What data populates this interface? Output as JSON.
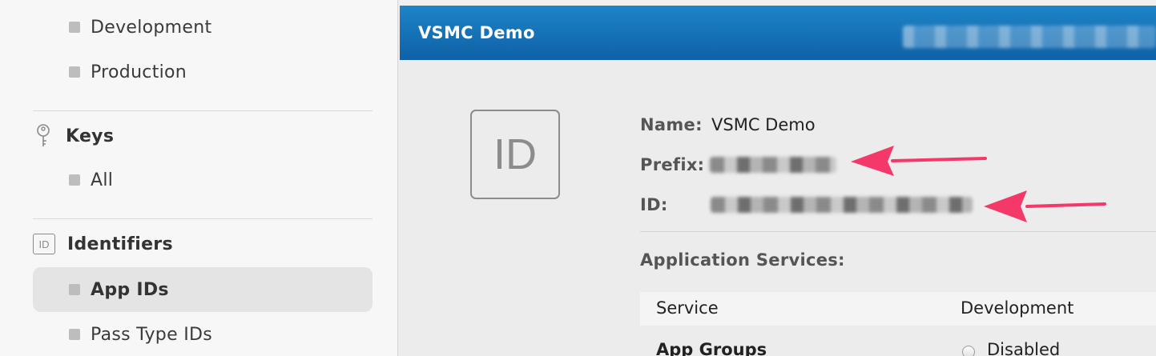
{
  "sidebar": {
    "certificates_items": [
      {
        "label": "Development"
      },
      {
        "label": "Production"
      }
    ],
    "keys": {
      "title": "Keys",
      "icon": "key-icon",
      "items": [
        {
          "label": "All"
        }
      ]
    },
    "identifiers": {
      "title": "Identifiers",
      "icon_text": "ID",
      "items": [
        {
          "label": "App IDs",
          "selected": true
        },
        {
          "label": "Pass Type IDs"
        }
      ]
    }
  },
  "main": {
    "header_title": "VSMC Demo",
    "badge_text": "ID",
    "name_label": "Name:",
    "name_value": "VSMC Demo",
    "prefix_label": "Prefix:",
    "id_label": "ID:",
    "services_title": "Application Services:",
    "table": {
      "columns": [
        "Service",
        "Development"
      ],
      "rows": [
        {
          "service": "App Groups",
          "development": "Disabled"
        }
      ]
    }
  },
  "colors": {
    "header_top": "#1e84c8",
    "header_bottom": "#0e61a6",
    "arrow": "#f5386a",
    "selected_bg": "#e4e4e4"
  }
}
